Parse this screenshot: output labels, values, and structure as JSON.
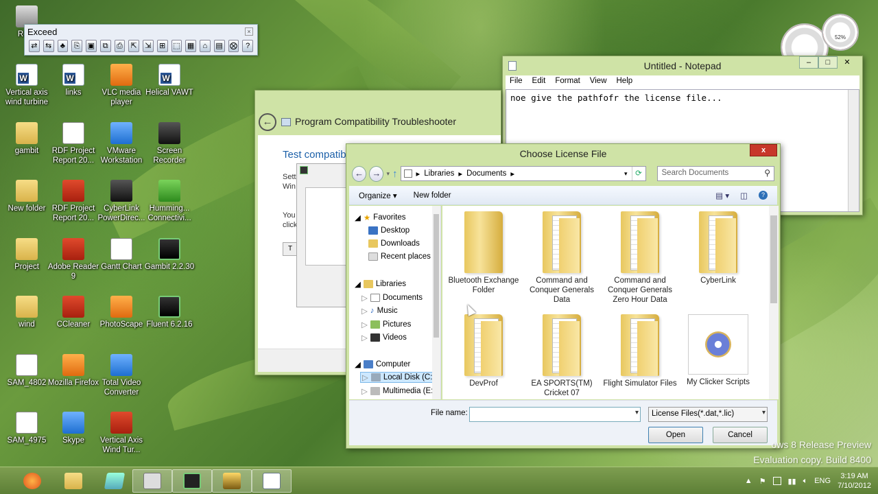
{
  "desktop": {
    "icons": [
      {
        "label": "Recy",
        "icon": "recycle-bin-icon"
      },
      {
        "label": "Vertical axis wind turbine",
        "icon": "word-doc-icon"
      },
      {
        "label": "links",
        "icon": "word-doc-icon"
      },
      {
        "label": "VLC media player",
        "icon": "vlc-icon"
      },
      {
        "label": "Helical VAWT",
        "icon": "word-doc-icon"
      },
      {
        "label": "gambit",
        "icon": "folder-icon"
      },
      {
        "label": "RDF Project Report 20...",
        "icon": "doc-icon"
      },
      {
        "label": "VMware Workstation",
        "icon": "vmware-icon"
      },
      {
        "label": "Screen Recorder",
        "icon": "screen-recorder-icon"
      },
      {
        "label": "New folder",
        "icon": "folder-icon"
      },
      {
        "label": "RDF Project Report 20...",
        "icon": "pdf-icon"
      },
      {
        "label": "CyberLink PowerDirec...",
        "icon": "cyberlink-icon"
      },
      {
        "label": "Humming... Connectivi...",
        "icon": "hummingbird-icon"
      },
      {
        "label": "Project",
        "icon": "folder-icon"
      },
      {
        "label": "Adobe Reader 9",
        "icon": "adobe-reader-icon"
      },
      {
        "label": "Gantt Chart",
        "icon": "gantt-chart-icon"
      },
      {
        "label": "Gambit 2.2.30",
        "icon": "gambit-icon"
      },
      {
        "label": "wind",
        "icon": "folder-icon"
      },
      {
        "label": "CCleaner",
        "icon": "ccleaner-icon"
      },
      {
        "label": "PhotoScape",
        "icon": "photoscape-icon"
      },
      {
        "label": "Fluent 6.2.16",
        "icon": "fluent-icon"
      },
      {
        "label": "SAM_4802",
        "icon": "image-icon"
      },
      {
        "label": "Mozilla Firefox",
        "icon": "firefox-icon"
      },
      {
        "label": "Total Video Converter",
        "icon": "video-converter-icon"
      },
      {
        "label": "SAM_4975",
        "icon": "image-icon"
      },
      {
        "label": "Skype",
        "icon": "skype-icon"
      },
      {
        "label": "Vertical Axis Wind Tur...",
        "icon": "pdf-icon"
      }
    ],
    "watermark": {
      "line1": "ows 8 Release Preview",
      "line2": "Evaluation copy. Build 8400"
    },
    "gadget": {
      "value": "52%"
    }
  },
  "exceed": {
    "title": "Exceed",
    "close": "×",
    "tools": [
      "⇄",
      "⇆",
      "♣",
      "⎘",
      "▣",
      "⧉",
      "⎙",
      "⇱",
      "⇲",
      "⊞",
      "⬚",
      "▦",
      "⌂",
      "▤",
      "⨂",
      "?"
    ]
  },
  "notepad": {
    "title": "Untitled - Notepad",
    "menu": [
      "File",
      "Edit",
      "Format",
      "View",
      "Help"
    ],
    "content": "noe give the pathfofr the license file..."
  },
  "troubleshooter": {
    "title": "Program Compatibility Troubleshooter",
    "heading": "Test compatib",
    "line1": "Sett",
    "line2": "Win",
    "line3": "You",
    "line4": "click",
    "button": "T"
  },
  "dialog": {
    "title": "Choose License File",
    "close": "x",
    "breadcrumb": [
      "Libraries",
      "Documents"
    ],
    "search_placeholder": "Search Documents",
    "organize": "Organize",
    "new_folder": "New folder",
    "nav": {
      "favorites": "Favorites",
      "desktop": "Desktop",
      "downloads": "Downloads",
      "recent": "Recent places",
      "libraries": "Libraries",
      "documents": "Documents",
      "music": "Music",
      "pictures": "Pictures",
      "videos": "Videos",
      "computer": "Computer",
      "local_disk": "Local Disk (C:)",
      "multimedia": "Multimedia (E:)"
    },
    "files": [
      {
        "name": "Bluetooth Exchange Folder"
      },
      {
        "name": "Command and Conquer Generals Data"
      },
      {
        "name": "Command and Conquer Generals Zero Hour Data"
      },
      {
        "name": "CyberLink"
      },
      {
        "name": "DevProf"
      },
      {
        "name": "EA SPORTS(TM) Cricket 07"
      },
      {
        "name": "Flight Simulator Files"
      },
      {
        "name": "My Clicker Scripts"
      }
    ],
    "file_name_label": "File name:",
    "file_name_value": "",
    "filter": "License Files(*.dat,*.lic)",
    "open": "Open",
    "cancel": "Cancel"
  },
  "taskbar": {
    "lang": "ENG",
    "time": "3:19 AM",
    "date": "7/10/2012"
  }
}
